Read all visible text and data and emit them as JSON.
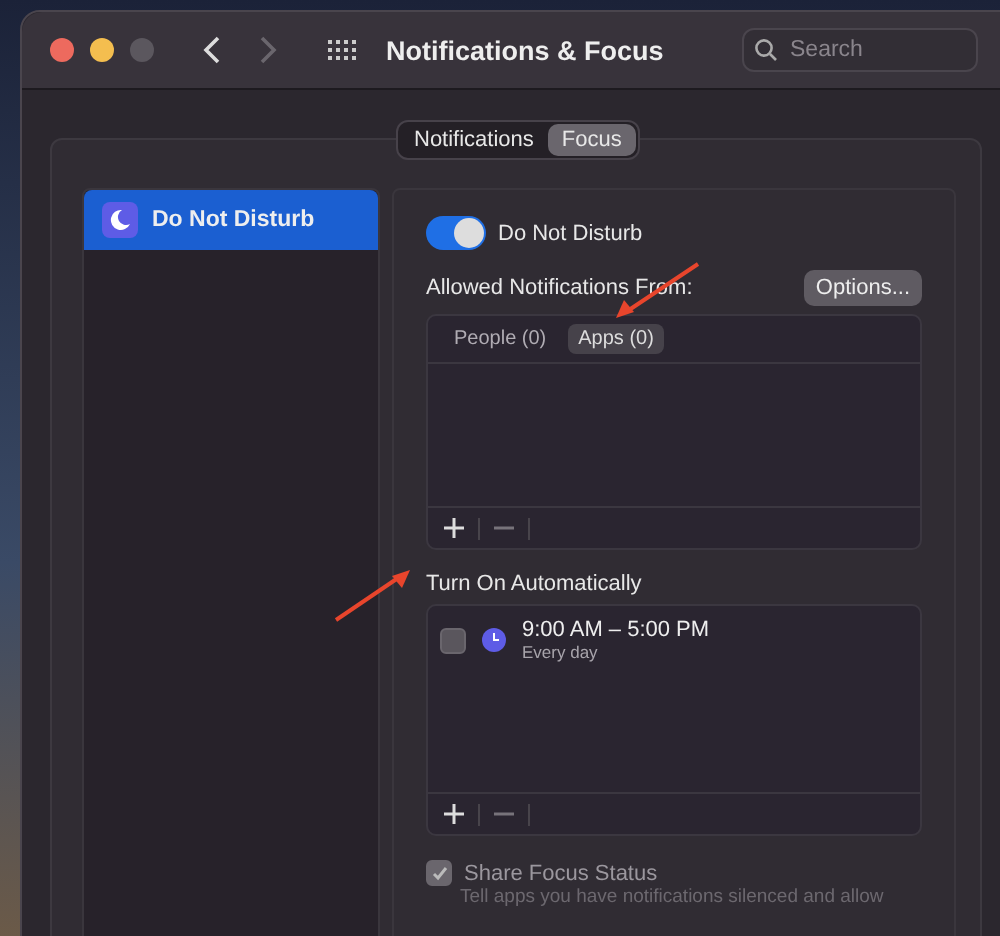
{
  "window": {
    "title": "Notifications & Focus",
    "search": {
      "placeholder": "Search"
    }
  },
  "segments": [
    {
      "label": "Notifications",
      "selected": false
    },
    {
      "label": "Focus",
      "selected": true
    }
  ],
  "sidebar": {
    "items": [
      {
        "label": "Do Not Disturb",
        "selected": true
      }
    ]
  },
  "focus": {
    "toggle": {
      "label": "Do Not Disturb",
      "on": true
    },
    "allowed": {
      "heading": "Allowed Notifications From:",
      "options_button": "Options...",
      "tabs": [
        {
          "label": "People (0)",
          "selected": false
        },
        {
          "label": "Apps (0)",
          "selected": true
        }
      ]
    },
    "automatic": {
      "heading": "Turn On Automatically",
      "items": [
        {
          "time": "9:00 AM – 5:00 PM",
          "repeat": "Every day",
          "checked": false
        }
      ]
    },
    "share": {
      "label": "Share Focus Status",
      "checked": true,
      "description": "Tell apps you have notifications silenced and allow"
    }
  }
}
